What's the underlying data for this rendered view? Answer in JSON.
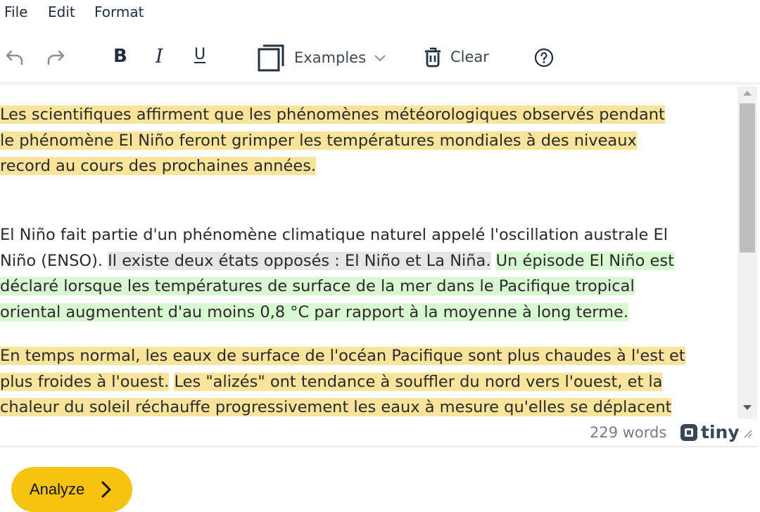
{
  "menubar": {
    "items": [
      "File",
      "Edit",
      "Format"
    ]
  },
  "toolbar": {
    "undo": "undo-icon",
    "redo": "redo-icon",
    "bold": "B",
    "italic": "I",
    "underline": "U",
    "examples_label": "Examples",
    "clear_label": "Clear",
    "help": "help-icon"
  },
  "colors": {
    "highlight_yellow": "#fae49b",
    "highlight_green": "#d7f8d0",
    "highlight_gray": "#e6e6e6",
    "analyze_button": "#f7c311"
  },
  "content": {
    "p1": [
      "Les scientifiques affirment que les phénomènes météorologiques observés pendant",
      "le phénomène El Niño feront grimper les températures mondiales à des niveaux",
      "record au cours des prochaines années."
    ],
    "p2": {
      "l1": "El Niño fait partie d'un phénomène climatique naturel appelé l'oscillation australe El",
      "l2a": "Niño (ENSO). ",
      "l2b": "Il existe deux états opposés : El Niño et La Niña.",
      "l2c": "Un épisode El Niño est",
      "l3": "déclaré lorsque les températures de surface de la mer dans le Pacifique tropical",
      "l4": "oriental augmentent d'au moins 0,8 °C par rapport à la moyenne à long terme."
    },
    "p3": {
      "l1": "En temps normal, les eaux de surface de l'océan Pacifique sont plus chaudes à l'est et",
      "l2a": "plus froides à l'ouest.",
      "l2b": "Les \"alizés\" ont tendance à souffler du nord vers l'ouest, et la",
      "l3": "chaleur du soleil réchauffe progressivement les eaux à mesure qu'elles se déplacent"
    }
  },
  "statusbar": {
    "word_count": "229 words",
    "brand": "tiny"
  },
  "analyze": {
    "label": "Analyze"
  }
}
